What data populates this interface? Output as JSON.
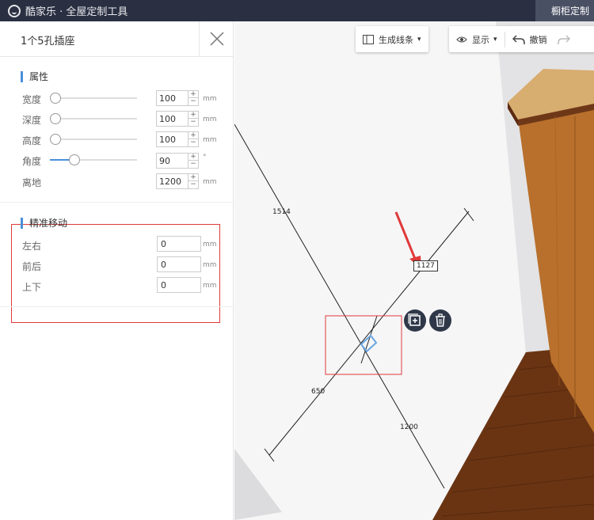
{
  "app": {
    "title": "酷家乐 · 全屋定制工具",
    "module": "橱柜定制"
  },
  "panel": {
    "title": "1个5孔插座",
    "props_title": "属性",
    "props": [
      {
        "label": "宽度",
        "value": "100",
        "unit": "mm",
        "slider": 0.0
      },
      {
        "label": "深度",
        "value": "100",
        "unit": "mm",
        "slider": 0.0
      },
      {
        "label": "高度",
        "value": "100",
        "unit": "mm",
        "slider": 0.0
      },
      {
        "label": "角度",
        "value": "90",
        "unit": "°",
        "slider": 0.25
      },
      {
        "label": "离地",
        "value": "1200",
        "unit": "mm"
      }
    ],
    "move_title": "精准移动",
    "move": [
      {
        "label": "左右",
        "value": "0",
        "unit": "mm"
      },
      {
        "label": "前后",
        "value": "0",
        "unit": "mm"
      },
      {
        "label": "上下",
        "value": "0",
        "unit": "mm"
      }
    ],
    "stepper": {
      "plus": "+",
      "minus": "−"
    }
  },
  "toolbar": {
    "gen_lines": "生成线条",
    "display": "显示",
    "undo": "撤销"
  },
  "scene": {
    "dims": {
      "d1514": "1514",
      "d1127": "1127",
      "d650": "650",
      "d1200": "1200"
    },
    "colors": {
      "wall": "#f5f5f6",
      "wood": "#b8702c",
      "floor": "#6a3413",
      "accent": "#4a90d9",
      "highlight": "#e03a3a"
    }
  }
}
